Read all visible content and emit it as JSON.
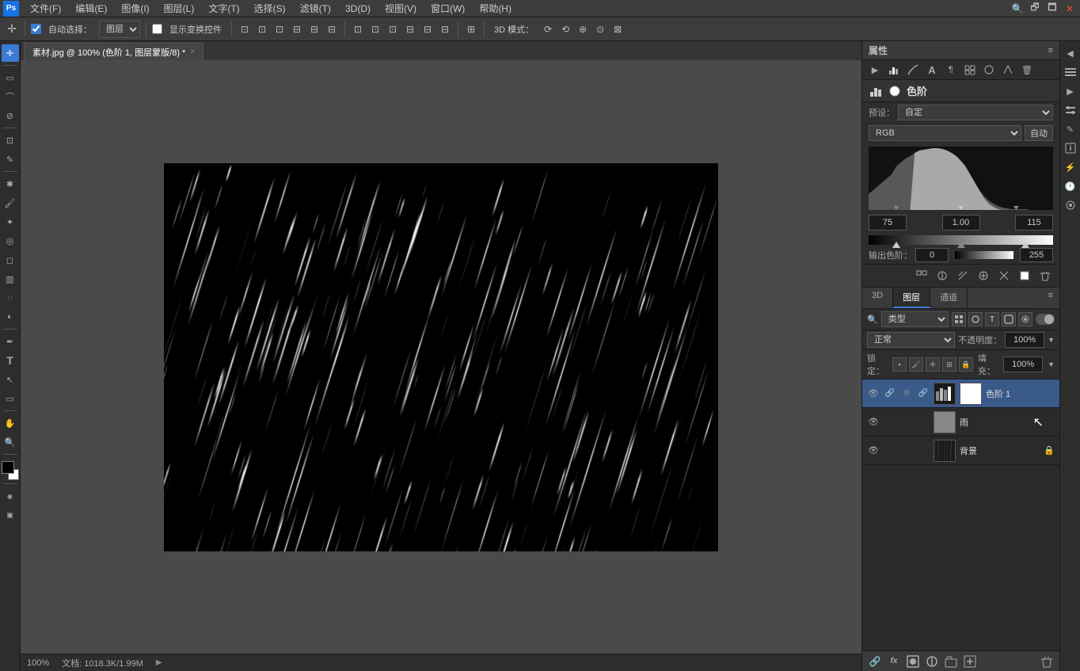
{
  "app": {
    "title": "Photoshop",
    "logo": "Ps"
  },
  "menu": {
    "items": [
      "文件(F)",
      "编辑(E)",
      "图像(I)",
      "图层(L)",
      "文字(T)",
      "选择(S)",
      "滤镜(T)",
      "3D(D)",
      "视图(V)",
      "窗口(W)",
      "帮助(H)"
    ]
  },
  "toolbar": {
    "auto_select_label": "自动选择：",
    "layer_label": "图层",
    "show_transform_label": "显示变换控件",
    "mode_3d_label": "3D 模式："
  },
  "tab": {
    "filename": "素材.jpg @ 100% (色阶 1, 图层蒙版/8) *",
    "close": "×"
  },
  "properties": {
    "title": "属性",
    "section_title": "色阶",
    "preset_label": "预设：",
    "preset_value": "自定",
    "channel_label": "RGB",
    "auto_btn": "自动",
    "levels": {
      "black_point": "75",
      "gamma": "1.00",
      "white_point": "115"
    },
    "output_label": "输出色阶：",
    "output_black": "0",
    "output_white": "255"
  },
  "layers_panel": {
    "title": "图层",
    "tab_3d": "3D",
    "tab_layers": "图层",
    "tab_channels": "通道",
    "filter_label": "类型",
    "blend_mode": "正常",
    "opacity_label": "不透明度：",
    "opacity_value": "100%",
    "lock_label": "锁定：",
    "fill_label": "填充：",
    "fill_value": "100%",
    "layers": [
      {
        "id": "levels-1",
        "name": "色阶 1",
        "type": "adjustment",
        "thumb_type": "white",
        "visible": true,
        "active": true,
        "has_mask": true
      },
      {
        "id": "rain",
        "name": "雨",
        "type": "normal",
        "thumb_type": "gray",
        "visible": true,
        "active": false,
        "has_mask": false
      },
      {
        "id": "background",
        "name": "背景",
        "type": "background",
        "thumb_type": "photo",
        "visible": true,
        "active": false,
        "has_mask": false,
        "locked": true
      }
    ],
    "bottom_buttons": [
      "link-icon",
      "fx-icon",
      "mask-icon",
      "adjustment-icon",
      "group-icon",
      "new-layer-icon",
      "delete-icon"
    ]
  },
  "status_bar": {
    "zoom": "100%",
    "doc_size": "文档: 1018.3K/1.99M"
  },
  "cursor": {
    "visible": true
  }
}
